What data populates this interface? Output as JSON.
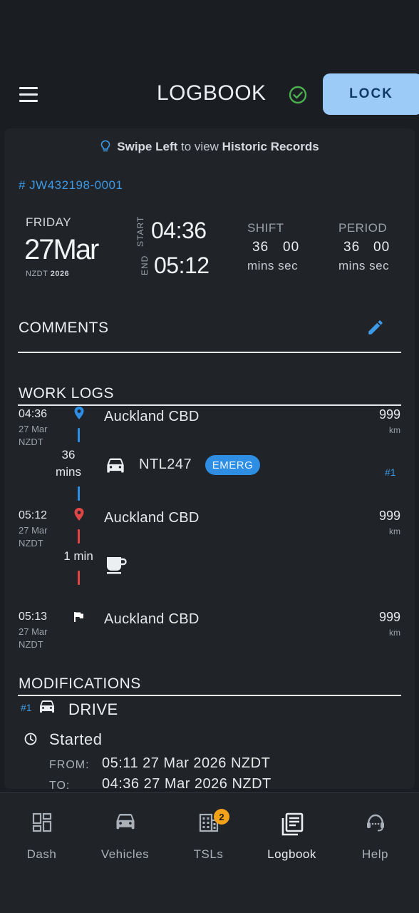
{
  "header": {
    "title": "LOGBOOK",
    "lock_label": "LOCK",
    "status_color": "#4caf50"
  },
  "hint": {
    "bold1": "Swipe Left",
    "middle": "to view",
    "bold2": "Historic Records"
  },
  "record": {
    "id": "# JW432198-0001",
    "day": "FRIDAY",
    "date": "27Mar",
    "tz": "NZDT",
    "year": "2026",
    "start_label": "START",
    "start_time": "04:36",
    "end_label": "END",
    "end_time": "05:12"
  },
  "shift": {
    "label": "SHIFT",
    "mins": "36",
    "secs": "00",
    "units": "mins sec"
  },
  "period": {
    "label": "PERIOD",
    "mins": "36",
    "secs": "00",
    "units": "mins sec"
  },
  "comments": {
    "title": "COMMENTS"
  },
  "work_logs": {
    "title": "WORK LOGS",
    "entries": [
      {
        "time": "04:36",
        "date": "27 Mar",
        "tz": "NZDT",
        "location": "Auckland CBD",
        "odometer": "999",
        "unit": "km",
        "marker_color": "#2d8ee4"
      },
      {
        "time": "05:12",
        "date": "27 Mar",
        "tz": "NZDT",
        "location": "Auckland CBD",
        "odometer": "999",
        "unit": "km",
        "marker_color": "#e04646"
      },
      {
        "time": "05:13",
        "date": "27 Mar",
        "tz": "NZDT",
        "location": "Auckland CBD",
        "odometer": "999",
        "unit": "km",
        "marker_color": "#ffffff"
      }
    ],
    "drive": {
      "duration_num": "36",
      "duration_unit": "mins",
      "vehicle_reg": "NTL247",
      "tag": "EMERG",
      "seq": "#1"
    },
    "break": {
      "duration": "1 min"
    }
  },
  "modifications": {
    "title": "MODIFICATIONS",
    "seq": "#1",
    "type": "DRIVE",
    "action": "Started",
    "from_label": "FROM:",
    "from_value": "05:11 27 Mar 2026 NZDT",
    "to_label": "TO:",
    "to_value": "04:36 27 Mar 2026 NZDT"
  },
  "nav": {
    "items": [
      {
        "label": "Dash",
        "icon": "dashboard-icon"
      },
      {
        "label": "Vehicles",
        "icon": "car-icon"
      },
      {
        "label": "TSLs",
        "icon": "building-icon",
        "badge": "2"
      },
      {
        "label": "Logbook",
        "icon": "logbook-icon",
        "active": true
      },
      {
        "label": "Help",
        "icon": "headset-icon"
      }
    ]
  }
}
